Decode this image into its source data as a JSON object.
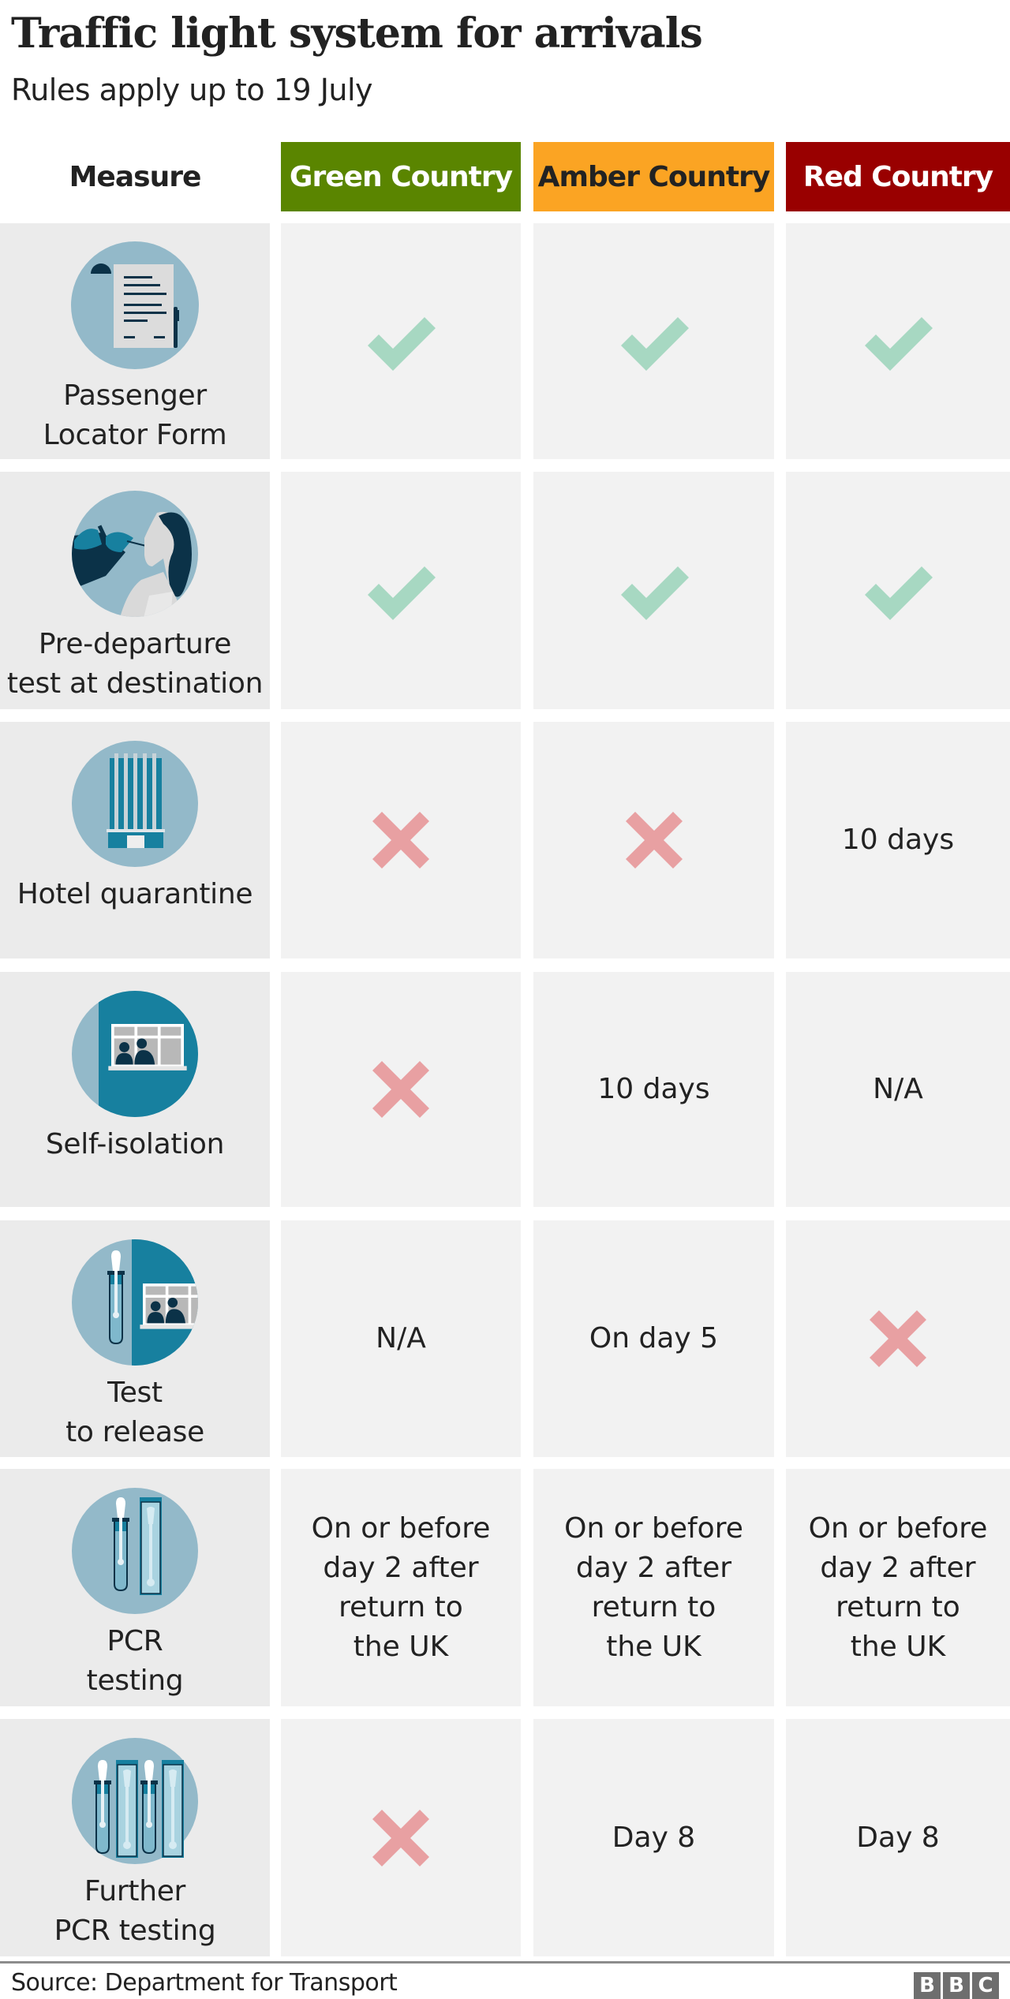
{
  "title": "Traffic light system for arrivals",
  "subtitle": "Rules apply up to 19 July",
  "colors": {
    "green": "#5a8500",
    "amber": "#fba423",
    "red": "#990000",
    "tick": "#a7d8c2",
    "cross": "#e8a0a2",
    "icon_circle": "#93b9c9",
    "icon_dark": "#0b3248",
    "icon_teal": "#17809f"
  },
  "headers": {
    "measure": "Measure",
    "green": "Green Country",
    "amber": "Amber Country",
    "red": "Red Country"
  },
  "rows": [
    {
      "measure": "Passenger\nLocator Form",
      "icon": "document-icon",
      "green": {
        "type": "tick",
        "text": ""
      },
      "amber": {
        "type": "tick",
        "text": ""
      },
      "red": {
        "type": "tick",
        "text": ""
      }
    },
    {
      "measure": "Pre-departure\ntest at destination",
      "icon": "swab-test-icon",
      "green": {
        "type": "tick",
        "text": ""
      },
      "amber": {
        "type": "tick",
        "text": ""
      },
      "red": {
        "type": "tick",
        "text": ""
      }
    },
    {
      "measure": "Hotel quarantine",
      "icon": "hotel-icon",
      "green": {
        "type": "cross",
        "text": ""
      },
      "amber": {
        "type": "cross",
        "text": ""
      },
      "red": {
        "type": "text",
        "text": "10 days"
      }
    },
    {
      "measure": "Self-isolation",
      "icon": "window-people-icon",
      "green": {
        "type": "cross",
        "text": ""
      },
      "amber": {
        "type": "text",
        "text": "10 days"
      },
      "red": {
        "type": "text",
        "text": "N/A"
      }
    },
    {
      "measure": "Test\nto release",
      "icon": "test-tube-window-icon",
      "green": {
        "type": "text",
        "text": "N/A"
      },
      "amber": {
        "type": "text",
        "text": "On day 5"
      },
      "red": {
        "type": "cross",
        "text": ""
      }
    },
    {
      "measure": "PCR\ntesting",
      "icon": "pcr-kit-icon",
      "green": {
        "type": "text",
        "text": "On or before\nday 2 after\nreturn to\nthe UK"
      },
      "amber": {
        "type": "text",
        "text": "On or before\nday 2 after\nreturn to\nthe UK"
      },
      "red": {
        "type": "text",
        "text": "On or before\nday 2 after\nreturn to\nthe UK"
      }
    },
    {
      "measure": "Further\nPCR testing",
      "icon": "double-pcr-kit-icon",
      "green": {
        "type": "cross",
        "text": ""
      },
      "amber": {
        "type": "text",
        "text": "Day 8"
      },
      "red": {
        "type": "text",
        "text": "Day 8"
      }
    }
  ],
  "source": "Source: Department for Transport",
  "logo": [
    "B",
    "B",
    "C"
  ]
}
